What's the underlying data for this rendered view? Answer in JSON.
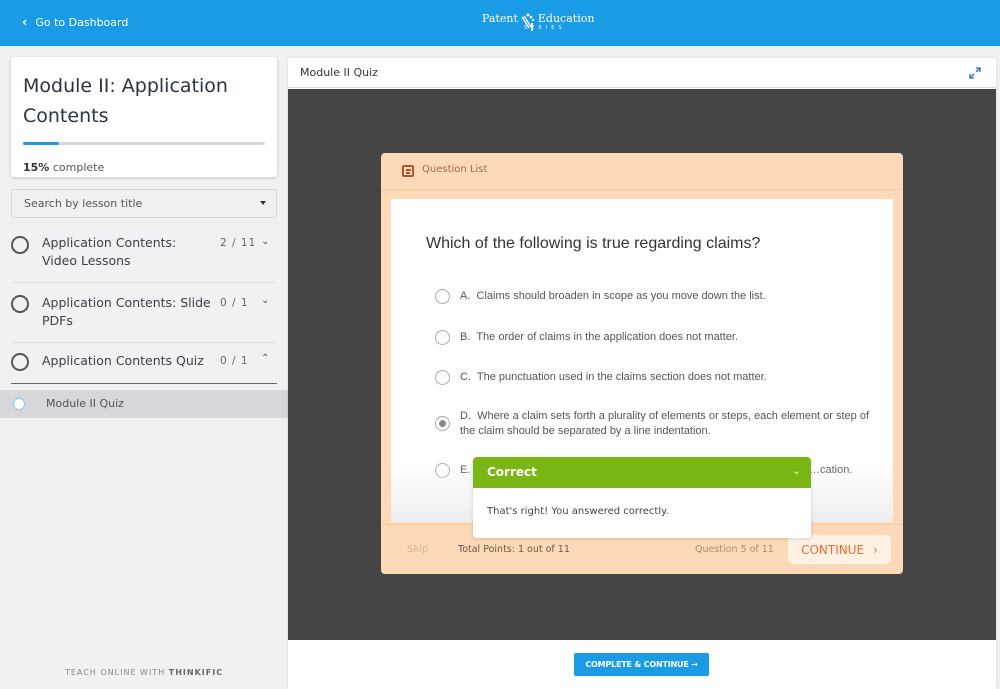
{
  "topbar": {
    "back_label": "Go to Dashboard",
    "logo": {
      "word1": "Patent",
      "word2": "Education",
      "sub": "SERIES"
    },
    "bg_color": "#1a9be6"
  },
  "sidebar": {
    "module_title": "Module II: Application Contents",
    "progress_percent": 15,
    "progress_value": "15%",
    "progress_suffix": "complete",
    "search_placeholder": "Search by lesson title",
    "chapters": [
      {
        "title": "Application Contents: Video Lessons",
        "count": "2 / 11",
        "expanded": false
      },
      {
        "title": "Application Contents: Slide PDFs",
        "count": "0 / 1",
        "expanded": false
      },
      {
        "title": "Application Contents Quiz",
        "count": "0 / 1",
        "expanded": true
      }
    ],
    "active_lesson": "Module II Quiz",
    "footer_prefix": "TEACH ONLINE WITH ",
    "footer_brand": "THINKIFIC"
  },
  "main": {
    "title": "Module II Quiz",
    "quiz": {
      "question_list_label": "Question List",
      "question": "Which of the following is true regarding claims?",
      "answers": [
        {
          "letter": "A.",
          "text": "Claims should broaden in scope as you move down the list.",
          "selected": false
        },
        {
          "letter": "B.",
          "text": "The order of claims in the application does not matter.",
          "selected": false
        },
        {
          "letter": "C.",
          "text": "The punctuation used in the claims section does not matter.",
          "selected": false
        },
        {
          "letter": "D.",
          "text": "Where a claim sets forth a plurality of elements or steps, each element or step of the claim should be separated by a line indentation.",
          "selected": true
        },
        {
          "letter": "E.",
          "text": "…cation.",
          "selected": false
        }
      ],
      "skip_label": "Skip",
      "total_points": "Total Points: 1 out of 11",
      "question_number": "Question 5 of 11",
      "continue_label": "CONTINUE",
      "feedback": {
        "title": "Correct",
        "message": "That's right! You answered correctly.",
        "color": "#7ab616"
      }
    },
    "complete_button": "COMPLETE & CONTINUE →"
  }
}
